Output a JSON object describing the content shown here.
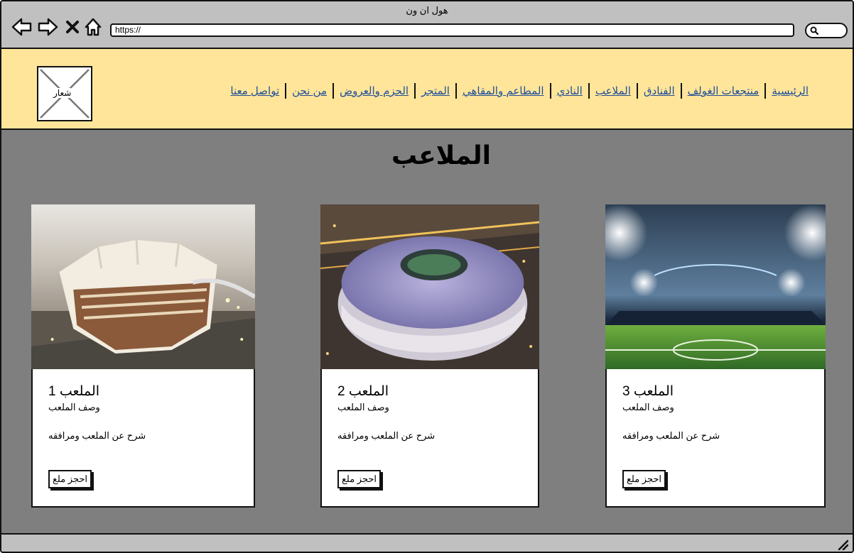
{
  "window": {
    "title": "هول ان ون"
  },
  "browser": {
    "url": "https://"
  },
  "logo": {
    "label": "شعار"
  },
  "nav": [
    {
      "label": "الرئيسية"
    },
    {
      "label": "منتجعات الغولف"
    },
    {
      "label": "الفنادق"
    },
    {
      "label": "الملاعب"
    },
    {
      "label": "النادي"
    },
    {
      "label": "المطاعم والمقاهي"
    },
    {
      "label": "المتجر"
    },
    {
      "label": "الحزم والعروض"
    },
    {
      "label": "من نحن"
    },
    {
      "label": "تواصل معنا"
    }
  ],
  "page": {
    "title": "الملاعب"
  },
  "cards": [
    {
      "title": "الملعب 1",
      "subtitle": "وصف الملعب",
      "detail": "شرح عن الملعب ومرافقه",
      "button": "احجز ملع"
    },
    {
      "title": "الملعب 2",
      "subtitle": "وصف الملعب",
      "detail": "شرح عن الملعب ومرافقه",
      "button": "احجز ملع"
    },
    {
      "title": "الملعب 3",
      "subtitle": "وصف الملعب",
      "detail": "شرح عن الملعب ومرافقه",
      "button": "احجز ملع"
    }
  ],
  "colors": {
    "header": "#ffe599",
    "chrome": "#c0c0c0",
    "page": "#7f7f7f",
    "link": "#1f4e9b"
  }
}
